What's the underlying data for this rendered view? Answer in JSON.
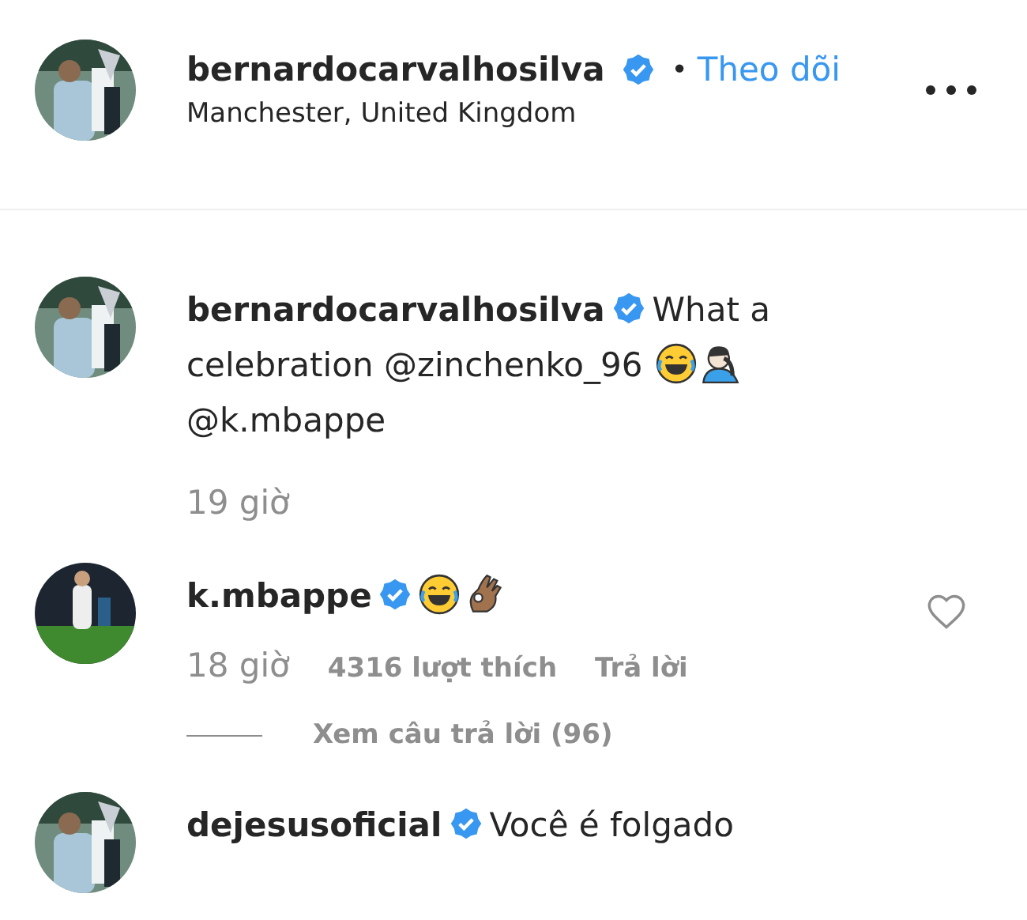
{
  "header": {
    "username": "bernardocarvalhosilva",
    "verified": true,
    "separator": "•",
    "follow": "Theo dõi",
    "location": "Manchester, United Kingdom"
  },
  "comments": [
    {
      "username": "bernardocarvalhosilva",
      "verified": true,
      "body": [
        {
          "kind": "text",
          "text": "What a"
        },
        {
          "kind": "text",
          "text": "celebration @zinchenko_96"
        },
        {
          "kind": "laugh"
        },
        {
          "kind": "facepalm"
        },
        {
          "kind": "text",
          "text": "@k.mbappe"
        }
      ],
      "time": "19 giờ"
    },
    {
      "username": "k.mbappe",
      "verified": true,
      "body": [
        {
          "kind": "laugh"
        },
        {
          "kind": "ok-hand"
        }
      ],
      "time": "18 giờ",
      "likes": "4316 lượt thích",
      "reply": "Trả lời",
      "view_replies": "Xem câu trả lời (96)",
      "liked": false
    },
    {
      "username": "dejesusoficial",
      "verified": true,
      "body": [
        {
          "kind": "text",
          "text": "Você é folgado"
        }
      ]
    }
  ]
}
